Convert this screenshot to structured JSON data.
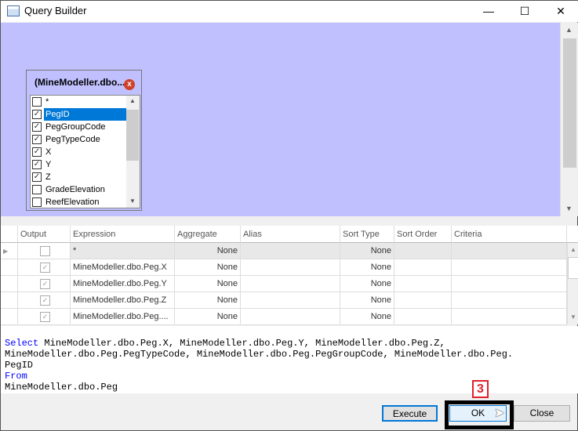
{
  "window": {
    "title": "Query Builder",
    "minimize": "—",
    "maximize": "☐",
    "close": "✕"
  },
  "table": {
    "title": "(MineModeller.dbo...",
    "items": [
      {
        "label": "*",
        "checked": false
      },
      {
        "label": "PegID",
        "checked": true,
        "selected": true
      },
      {
        "label": "PegGroupCode",
        "checked": true
      },
      {
        "label": "PegTypeCode",
        "checked": true
      },
      {
        "label": "X",
        "checked": true
      },
      {
        "label": "Y",
        "checked": true
      },
      {
        "label": "Z",
        "checked": true
      },
      {
        "label": "GradeElevation",
        "checked": false
      },
      {
        "label": "ReefElevation",
        "checked": false
      }
    ]
  },
  "grid": {
    "headers": [
      "Output",
      "Expression",
      "Aggregate",
      "Alias",
      "Sort Type",
      "Sort Order",
      "Criteria"
    ],
    "rows": [
      {
        "output": false,
        "expression": "*",
        "aggregate": "None",
        "sort_type": "None"
      },
      {
        "output": true,
        "expression": "MineModeller.dbo.Peg.X",
        "aggregate": "None",
        "sort_type": "None"
      },
      {
        "output": true,
        "expression": "MineModeller.dbo.Peg.Y",
        "aggregate": "None",
        "sort_type": "None"
      },
      {
        "output": true,
        "expression": "MineModeller.dbo.Peg.Z",
        "aggregate": "None",
        "sort_type": "None"
      },
      {
        "output": true,
        "expression": "MineModeller.dbo.Peg....",
        "aggregate": "None",
        "sort_type": "None"
      }
    ]
  },
  "sql": {
    "select_kw": "Select",
    "select_body": " MineModeller.dbo.Peg.X, MineModeller.dbo.Peg.Y, MineModeller.dbo.Peg.Z,\nMineModeller.dbo.Peg.PegTypeCode, MineModeller.dbo.Peg.PegGroupCode, MineModeller.dbo.Peg.\nPegID\n",
    "from_kw": "From",
    "from_body": "\nMineModeller.dbo.Peg"
  },
  "buttons": {
    "execute": "Execute",
    "ok": "OK",
    "close": "Close"
  },
  "annotation": {
    "step": "3"
  }
}
